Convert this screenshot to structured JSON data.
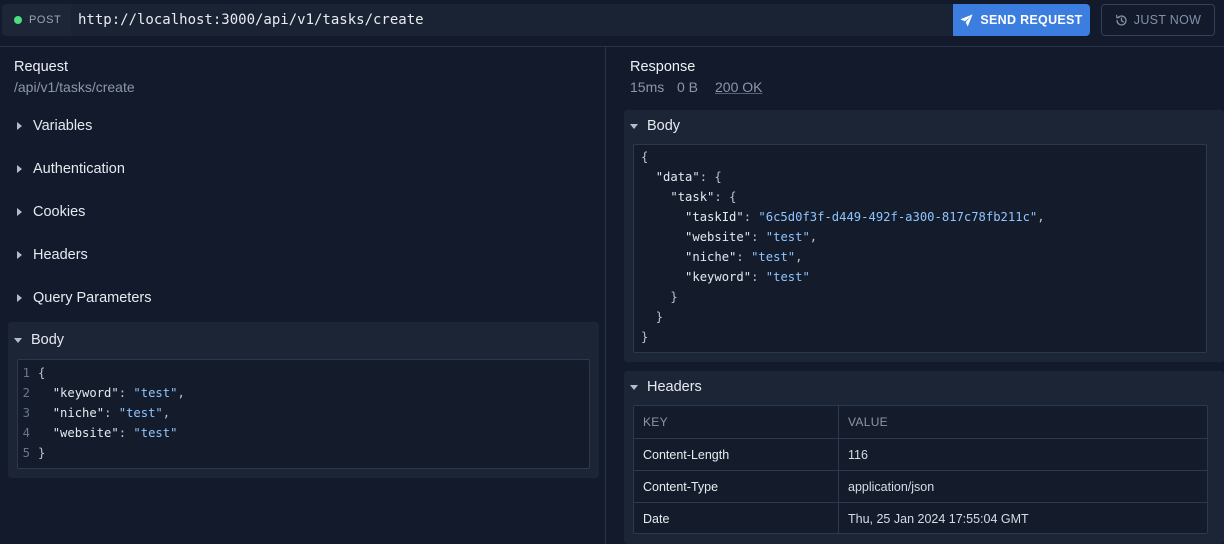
{
  "request_bar": {
    "method": "POST",
    "url": "http://localhost:3000/api/v1/tasks/create",
    "send_label": "SEND REQUEST",
    "history_label": "JUST NOW",
    "status_dot_color": "#4ade80",
    "accent": "#3c7de0"
  },
  "request": {
    "title": "Request",
    "path": "/api/v1/tasks/create",
    "sections": {
      "variables": "Variables",
      "authentication": "Authentication",
      "cookies": "Cookies",
      "headers": "Headers",
      "query": "Query Parameters",
      "body": "Body"
    },
    "body_lines": [
      {
        "n": "1",
        "parts": [
          {
            "t": "br",
            "v": "{"
          }
        ]
      },
      {
        "n": "2",
        "parts": [
          {
            "t": "p",
            "v": "  "
          },
          {
            "t": "k",
            "v": "\"keyword\""
          },
          {
            "t": "p",
            "v": ": "
          },
          {
            "t": "s",
            "v": "\"test\""
          },
          {
            "t": "p",
            "v": ","
          }
        ]
      },
      {
        "n": "3",
        "parts": [
          {
            "t": "p",
            "v": "  "
          },
          {
            "t": "k",
            "v": "\"niche\""
          },
          {
            "t": "p",
            "v": ": "
          },
          {
            "t": "s",
            "v": "\"test\""
          },
          {
            "t": "p",
            "v": ","
          }
        ]
      },
      {
        "n": "4",
        "parts": [
          {
            "t": "p",
            "v": "  "
          },
          {
            "t": "k",
            "v": "\"website\""
          },
          {
            "t": "p",
            "v": ": "
          },
          {
            "t": "s",
            "v": "\"test\""
          }
        ]
      },
      {
        "n": "5",
        "parts": [
          {
            "t": "br",
            "v": "}"
          }
        ]
      }
    ]
  },
  "response": {
    "title": "Response",
    "time": "15ms",
    "size": "0 B",
    "status": "200 OK",
    "body_title": "Body",
    "headers_title": "Headers",
    "body_lines": [
      [
        {
          "t": "br",
          "v": "{"
        }
      ],
      [
        {
          "t": "p",
          "v": "  "
        },
        {
          "t": "k",
          "v": "\"data\""
        },
        {
          "t": "p",
          "v": ": "
        },
        {
          "t": "br",
          "v": "{"
        }
      ],
      [
        {
          "t": "p",
          "v": "    "
        },
        {
          "t": "k",
          "v": "\"task\""
        },
        {
          "t": "p",
          "v": ": "
        },
        {
          "t": "br",
          "v": "{"
        }
      ],
      [
        {
          "t": "p",
          "v": "      "
        },
        {
          "t": "k",
          "v": "\"taskId\""
        },
        {
          "t": "p",
          "v": ": "
        },
        {
          "t": "s",
          "v": "\"6c5d0f3f-d449-492f-a300-817c78fb211c\""
        },
        {
          "t": "p",
          "v": ","
        }
      ],
      [
        {
          "t": "p",
          "v": "      "
        },
        {
          "t": "k",
          "v": "\"website\""
        },
        {
          "t": "p",
          "v": ": "
        },
        {
          "t": "s",
          "v": "\"test\""
        },
        {
          "t": "p",
          "v": ","
        }
      ],
      [
        {
          "t": "p",
          "v": "      "
        },
        {
          "t": "k",
          "v": "\"niche\""
        },
        {
          "t": "p",
          "v": ": "
        },
        {
          "t": "s",
          "v": "\"test\""
        },
        {
          "t": "p",
          "v": ","
        }
      ],
      [
        {
          "t": "p",
          "v": "      "
        },
        {
          "t": "k",
          "v": "\"keyword\""
        },
        {
          "t": "p",
          "v": ": "
        },
        {
          "t": "s",
          "v": "\"test\""
        }
      ],
      [
        {
          "t": "p",
          "v": "    "
        },
        {
          "t": "br",
          "v": "}"
        }
      ],
      [
        {
          "t": "p",
          "v": "  "
        },
        {
          "t": "br",
          "v": "}"
        }
      ],
      [
        {
          "t": "br",
          "v": "}"
        }
      ]
    ],
    "headers_table": {
      "columns": [
        "KEY",
        "VALUE"
      ],
      "rows": [
        [
          "Content-Length",
          "116"
        ],
        [
          "Content-Type",
          "application/json"
        ],
        [
          "Date",
          "Thu, 25 Jan 2024 17:55:04 GMT"
        ]
      ]
    }
  }
}
